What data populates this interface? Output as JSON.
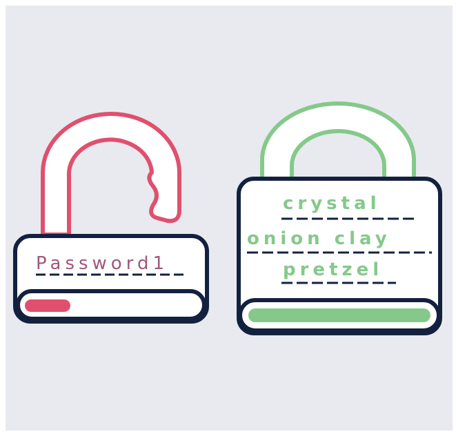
{
  "colors": {
    "background": "#e8eaef",
    "outline": "#13213f",
    "weak": "#e0506e",
    "weak_text": "#a0577a",
    "strong": "#85c98a",
    "lock_fill": "#ffffff"
  },
  "weak_lock": {
    "state": "unlocked",
    "password": "Password1",
    "strength_fraction": 0.25,
    "strength_color": "#e0506e"
  },
  "strong_lock": {
    "state": "locked",
    "passphrase_words": [
      "crystal",
      "onion clay",
      "pretzel"
    ],
    "strength_fraction": 1.0,
    "strength_color": "#85c98a"
  }
}
